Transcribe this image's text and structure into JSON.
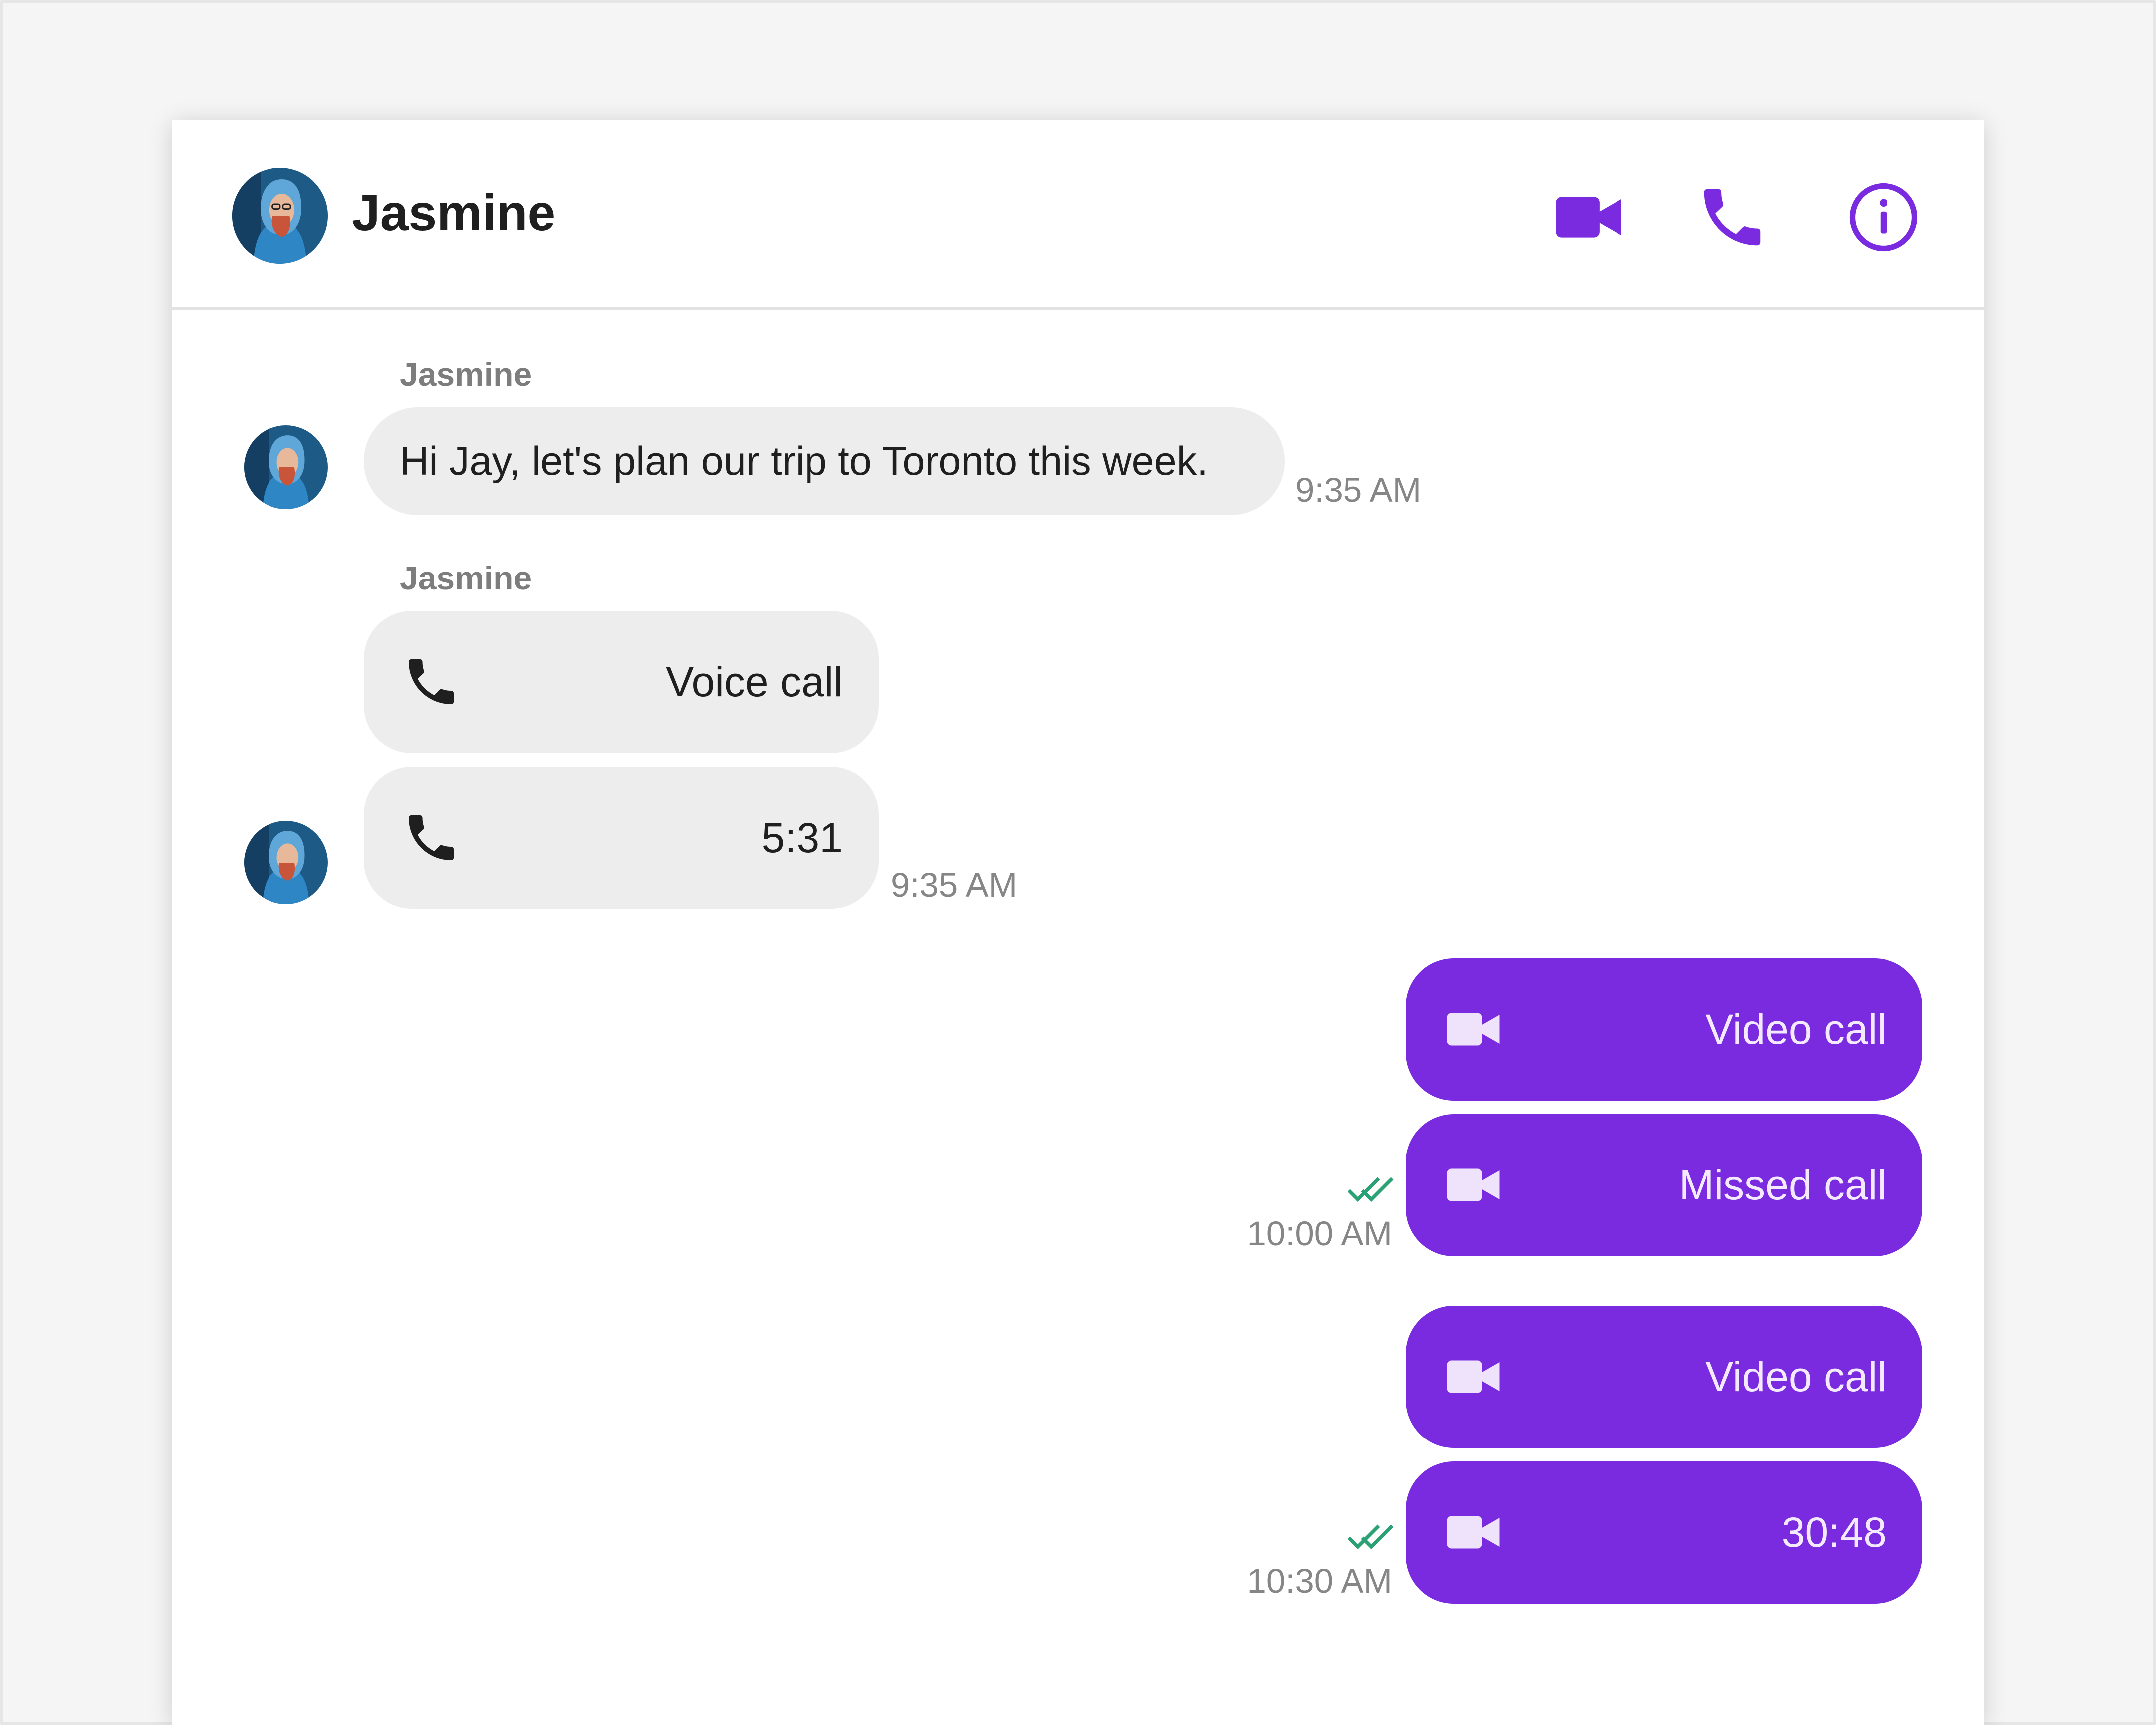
{
  "contact": {
    "name": "Jasmine"
  },
  "header_icons": [
    "video-camera-icon",
    "phone-icon",
    "info-icon"
  ],
  "colors": {
    "accent": "#7a2be0",
    "incoming_bubble": "#ededed",
    "read_ticks": "#2aa174",
    "muted_text": "#868686"
  },
  "messages": {
    "m1": {
      "sender": "Jasmine",
      "text": "Hi Jay, let's plan our trip to Toronto this week.",
      "time": "9:35 AM"
    },
    "m2": {
      "sender": "Jasmine",
      "label": "Voice call",
      "icon": "phone-icon"
    },
    "m3": {
      "label": "5:31",
      "time": "9:35 AM",
      "icon": "phone-icon"
    },
    "m4": {
      "label": "Video call",
      "icon": "video-camera-icon"
    },
    "m5": {
      "label": "Missed call",
      "time": "10:00 AM",
      "status": "read",
      "icon": "video-camera-icon"
    },
    "m6": {
      "label": "Video call",
      "icon": "video-camera-icon"
    },
    "m7": {
      "label": "30:48",
      "time": "10:30 AM",
      "status": "read",
      "icon": "video-camera-icon"
    }
  }
}
